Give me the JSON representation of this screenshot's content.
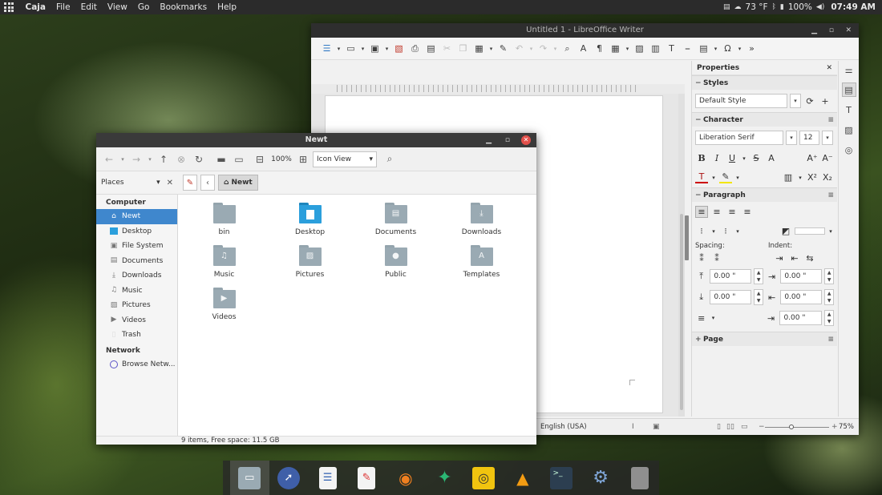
{
  "top_panel": {
    "menu": [
      "Caja",
      "File",
      "Edit",
      "View",
      "Go",
      "Bookmarks",
      "Help"
    ],
    "weather": "73 °F",
    "battery": "100%",
    "clock": "07:49 AM"
  },
  "writer": {
    "title": "Untitled 1 - LibreOffice Writer",
    "sidebar": {
      "title": "Properties",
      "styles_header": "Styles",
      "style_value": "Default Style",
      "character_header": "Character",
      "font_name": "Liberation Serif",
      "font_size": "12",
      "paragraph_header": "Paragraph",
      "spacing_label": "Spacing:",
      "indent_label": "Indent:",
      "spacing_above": "0.00 \"",
      "spacing_below": "0.00 \"",
      "indent_before": "0.00 \"",
      "indent_after": "0.00 \"",
      "indent_first": "0.00 \"",
      "page_header": "Page"
    },
    "status": {
      "language": "English (USA)",
      "zoom": "75%"
    }
  },
  "caja": {
    "title": "Newt",
    "zoom": "100%",
    "view_mode": "Icon View",
    "places_label": "Places",
    "crumb": "Newt",
    "sidebar": {
      "computer_header": "Computer",
      "computer_items": [
        "Newt",
        "Desktop",
        "File System",
        "Documents",
        "Downloads",
        "Music",
        "Pictures",
        "Videos",
        "Trash"
      ],
      "network_header": "Network",
      "network_items": [
        "Browse Netw..."
      ]
    },
    "files": [
      "bin",
      "Desktop",
      "Documents",
      "Downloads",
      "Music",
      "Pictures",
      "Public",
      "Templates",
      "Videos"
    ],
    "status": "9 items, Free space: 11.5 GB"
  },
  "colors": {
    "selection": "#3f87cd",
    "folder": "#9aaab3",
    "desktop_folder": "#2b9fdc",
    "close_button": "#e2504b"
  }
}
